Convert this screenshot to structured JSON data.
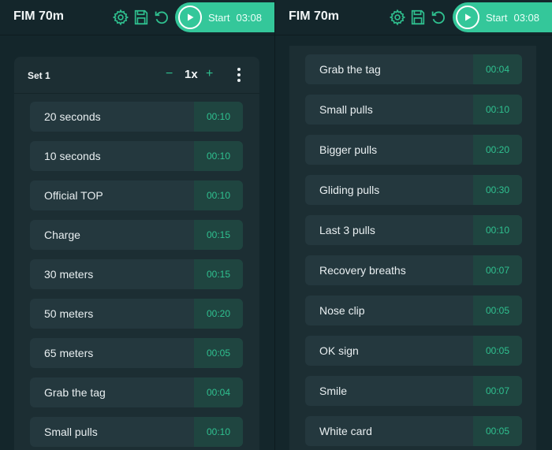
{
  "left": {
    "title": "FIM 70m",
    "start_label": "Start",
    "start_time": "03:08",
    "set": {
      "title": "Set 1",
      "minus": "−",
      "repeat": "1x",
      "plus": "+"
    },
    "steps": [
      {
        "name": "20 seconds",
        "time": "00:10"
      },
      {
        "name": "10 seconds",
        "time": "00:10"
      },
      {
        "name": "Official TOP",
        "time": "00:10"
      },
      {
        "name": "Charge",
        "time": "00:15"
      },
      {
        "name": "30 meters",
        "time": "00:15"
      },
      {
        "name": "50 meters",
        "time": "00:20"
      },
      {
        "name": "65 meters",
        "time": "00:05"
      },
      {
        "name": "Grab the tag",
        "time": "00:04"
      },
      {
        "name": "Small pulls",
        "time": "00:10"
      }
    ]
  },
  "right": {
    "title": "FIM 70m",
    "start_label": "Start",
    "start_time": "03:08",
    "steps": [
      {
        "name": "Grab the tag",
        "time": "00:04"
      },
      {
        "name": "Small pulls",
        "time": "00:10"
      },
      {
        "name": "Bigger pulls",
        "time": "00:20"
      },
      {
        "name": "Gliding pulls",
        "time": "00:30"
      },
      {
        "name": "Last 3 pulls",
        "time": "00:10"
      },
      {
        "name": "Recovery breaths",
        "time": "00:07"
      },
      {
        "name": "Nose clip",
        "time": "00:05"
      },
      {
        "name": "OK sign",
        "time": "00:05"
      },
      {
        "name": "Smile",
        "time": "00:07"
      },
      {
        "name": "White card",
        "time": "00:05"
      }
    ]
  },
  "icons": [
    "settings-gear-icon",
    "save-floppy-icon",
    "reset-icon",
    "play-icon",
    "more-vertical-icon"
  ],
  "colors": {
    "accent": "#34c79a",
    "background": "#14262b",
    "row": "#24383e",
    "time_cell": "#1f4540"
  }
}
